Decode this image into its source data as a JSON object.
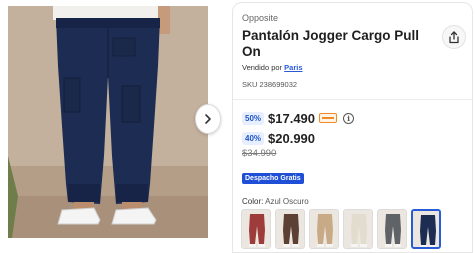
{
  "gallery": {
    "image_alt": "Pantalón jogger cargo azul oscuro, vista posterior",
    "next_icon": "chevron-right-icon"
  },
  "product": {
    "brand": "Opposite",
    "title": "Pantalón Jogger Cargo Pull On",
    "share_icon": "share-icon",
    "sold_by_label": "Vendido por",
    "seller": "Paris",
    "sku": "SKU 238699032"
  },
  "pricing": {
    "card_discount": "50%",
    "card_price": "$17.490",
    "card_icon": "card-badge-icon",
    "info_icon": "info-icon",
    "discount": "40%",
    "price": "$20.990",
    "original_price": "$34.990"
  },
  "shipping_badge": "Despacho Gratis",
  "color": {
    "label": "Color:",
    "value": "Azul Oscuro",
    "swatches": [
      {
        "name": "Rojo",
        "color": "#9e3b3b",
        "selected": false
      },
      {
        "name": "Café",
        "color": "#5c4033",
        "selected": false
      },
      {
        "name": "Beige",
        "color": "#c8ab86",
        "selected": false
      },
      {
        "name": "Blanco",
        "color": "#e2dccf",
        "selected": false
      },
      {
        "name": "Gris",
        "color": "#5f6266",
        "selected": false
      },
      {
        "name": "Azul Oscuro",
        "color": "#1d2c52",
        "selected": true
      }
    ]
  },
  "colors": {
    "accent": "#1f4fd6",
    "discount_badge_bg": "#e6eeff",
    "pants": "#1d2c52"
  }
}
